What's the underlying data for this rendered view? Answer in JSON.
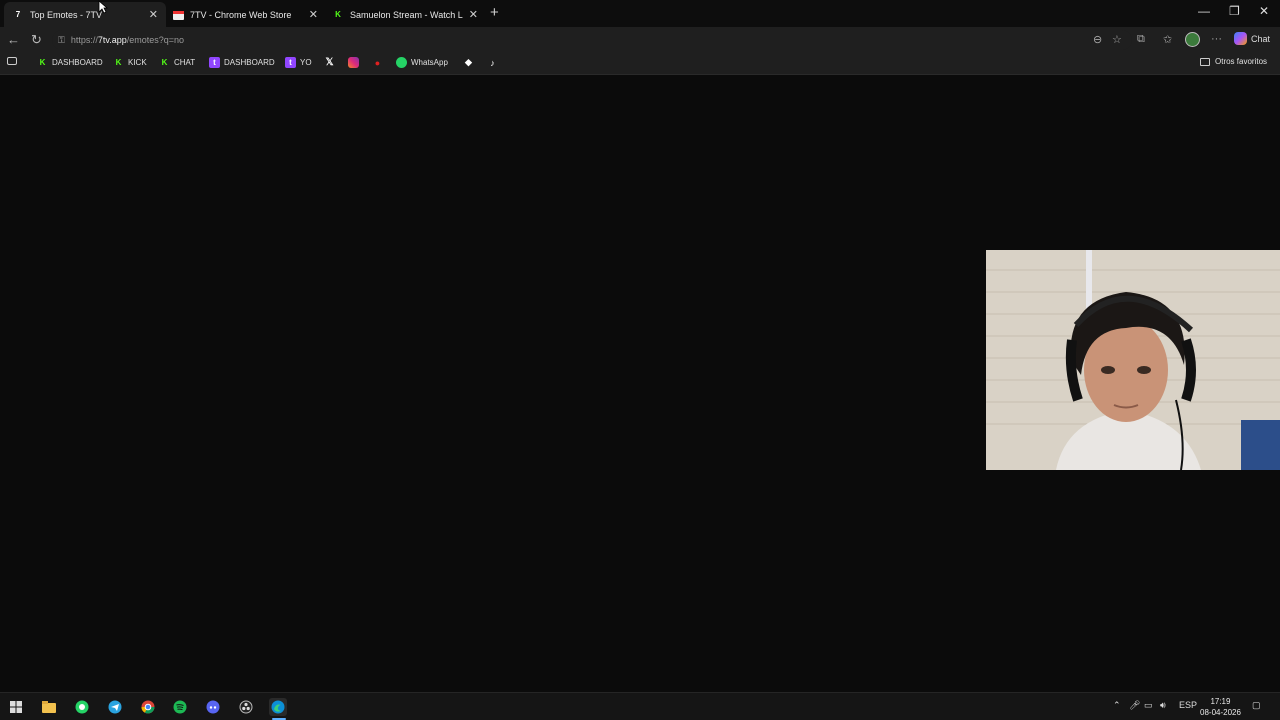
{
  "tabs": [
    {
      "title": "Top Emotes - 7TV",
      "favicon": "7tv-icon",
      "active": true
    },
    {
      "title": "7TV - Chrome Web Store",
      "favicon": "webstore-icon",
      "active": false
    },
    {
      "title": "Samuelon Stream - Watch Live on",
      "favicon": "kick-icon",
      "active": false
    }
  ],
  "address_bar": {
    "url_prefix": "https://",
    "url_domain": "7tv.app",
    "url_path": "/emotes?q=no"
  },
  "copilot_label": "Chat",
  "bookmarks": [
    {
      "label": "DASHBOARD",
      "icon": "kick-icon"
    },
    {
      "label": "KICK",
      "icon": "kick-icon"
    },
    {
      "label": "CHAT",
      "icon": "kick-icon"
    },
    {
      "label": "DASHBOARD",
      "icon": "twitch-icon"
    },
    {
      "label": "YO",
      "icon": "twitch-icon"
    },
    {
      "label": "",
      "icon": "x-icon"
    },
    {
      "label": "",
      "icon": "instagram-icon"
    },
    {
      "label": "",
      "icon": "youtube-icon"
    },
    {
      "label": "WhatsApp",
      "icon": "whatsapp-icon"
    },
    {
      "label": "",
      "icon": "diamond-icon"
    },
    {
      "label": "",
      "icon": "tiktok-icon"
    }
  ],
  "other_favorites": "Otros favoritos",
  "tray": {
    "language": "ESP",
    "time": "17:19",
    "date": "08-04-2026"
  },
  "colors": {
    "kick_green": "#53fc18",
    "twitch_purple": "#9146ff",
    "page_bg": "#0b0b0b"
  }
}
